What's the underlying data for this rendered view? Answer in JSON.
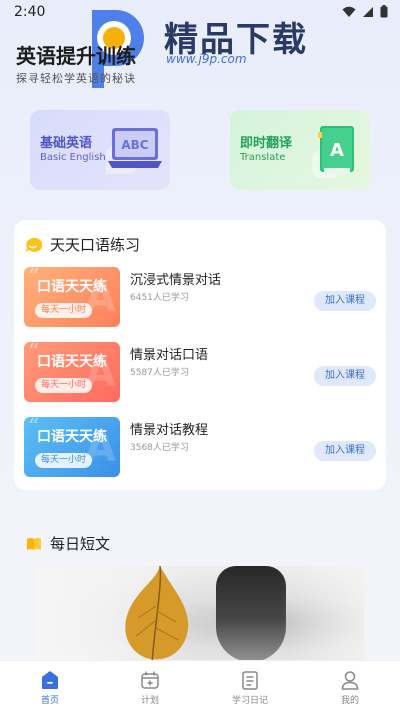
{
  "status_bar": {
    "time": "2:40"
  },
  "header": {
    "title": "英语提升训练",
    "subtitle": "探寻轻松学英语的秘诀"
  },
  "watermark": {
    "text": "精品下载",
    "url": "www.j9p.com"
  },
  "quick_cards": [
    {
      "title": "基础英语",
      "subtitle": "Basic English",
      "icon": "abc-laptop-icon"
    },
    {
      "title": "即时翻译",
      "subtitle": "Translate",
      "icon": "dictionary-book-icon",
      "book_letter": "A"
    }
  ],
  "oral_section": {
    "title": "天天口语练习",
    "icon": "chat-bubble-icon",
    "courses": [
      {
        "thumb_title": "口语天天练",
        "thumb_pill": "每天一小时",
        "title": "沉浸式情景对话",
        "count": "6451人已学习",
        "button": "加入课程",
        "theme": "orange"
      },
      {
        "thumb_title": "口语天天练",
        "thumb_pill": "每天一小时",
        "title": "情景对话口语",
        "count": "5587人已学习",
        "button": "加入课程",
        "theme": "red"
      },
      {
        "thumb_title": "口语天天练",
        "thumb_pill": "每天一小时",
        "title": "情景对话教程",
        "count": "3568人已学习",
        "button": "加入课程",
        "theme": "blue"
      }
    ]
  },
  "daily_section": {
    "title": "每日短文",
    "icon": "open-book-icon"
  },
  "tabbar": {
    "items": [
      {
        "label": "首页",
        "icon": "home-icon",
        "active": true
      },
      {
        "label": "计划",
        "icon": "calendar-icon",
        "active": false
      },
      {
        "label": "学习日记",
        "icon": "notebook-icon",
        "active": false
      },
      {
        "label": "我的",
        "icon": "user-icon",
        "active": false
      }
    ]
  },
  "colors": {
    "accent": "#3a6fe0",
    "button_bg": "#dfe9fb",
    "oral_icon": "#ffc21a",
    "daily_icon": "#ffb400"
  }
}
